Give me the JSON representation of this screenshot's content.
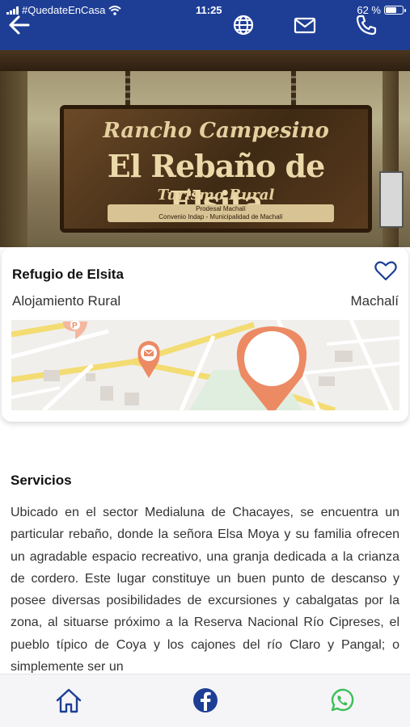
{
  "status_bar": {
    "carrier": "#QuedateEnCasa",
    "time": "11:25",
    "battery": "62 %"
  },
  "header": {
    "back_icon": "arrow-left-icon",
    "actions": [
      "globe-icon",
      "mail-icon",
      "phone-icon"
    ],
    "background_color": "#1e3e96"
  },
  "hero": {
    "sign_line1": "Rancho Campesino",
    "sign_line2": "El Rebaño de Elsita",
    "sign_line3": "Turismo Rural",
    "sign_plate_line1": "Prodesal Machalí",
    "sign_plate_line2": "Convenio Indap - Municipalidad de Machalí"
  },
  "listing": {
    "name": "Refugio de Elsita",
    "category": "Alojamiento Rural",
    "location": "Machalí",
    "favorite_icon": "heart-outline-icon",
    "accent_color": "#1e3e96",
    "map_pin_color": "#ec8a64"
  },
  "services": {
    "title": "Servicios",
    "description": "Ubicado en el sector Medialuna de Chacayes, se encuentra un particular rebaño, donde la señora Elsa Moya y su familia ofrecen un agradable espacio recreativo, una granja dedicada a la crianza de cordero. Este lugar constituye un buen punto de descanso y posee diversas posibilidades de excursiones y cabalgatas por la zona, al situarse próximo a la Reserva Nacional Río Cipreses, el pueblo típico de Coya y los cajones del río Claro y Pangal; o simplemente ser un"
  },
  "bottom_nav": {
    "items": [
      "home-icon",
      "facebook-icon",
      "whatsapp-icon"
    ],
    "whatsapp_color": "#3dbf5a",
    "icon_color": "#1e3e96"
  }
}
